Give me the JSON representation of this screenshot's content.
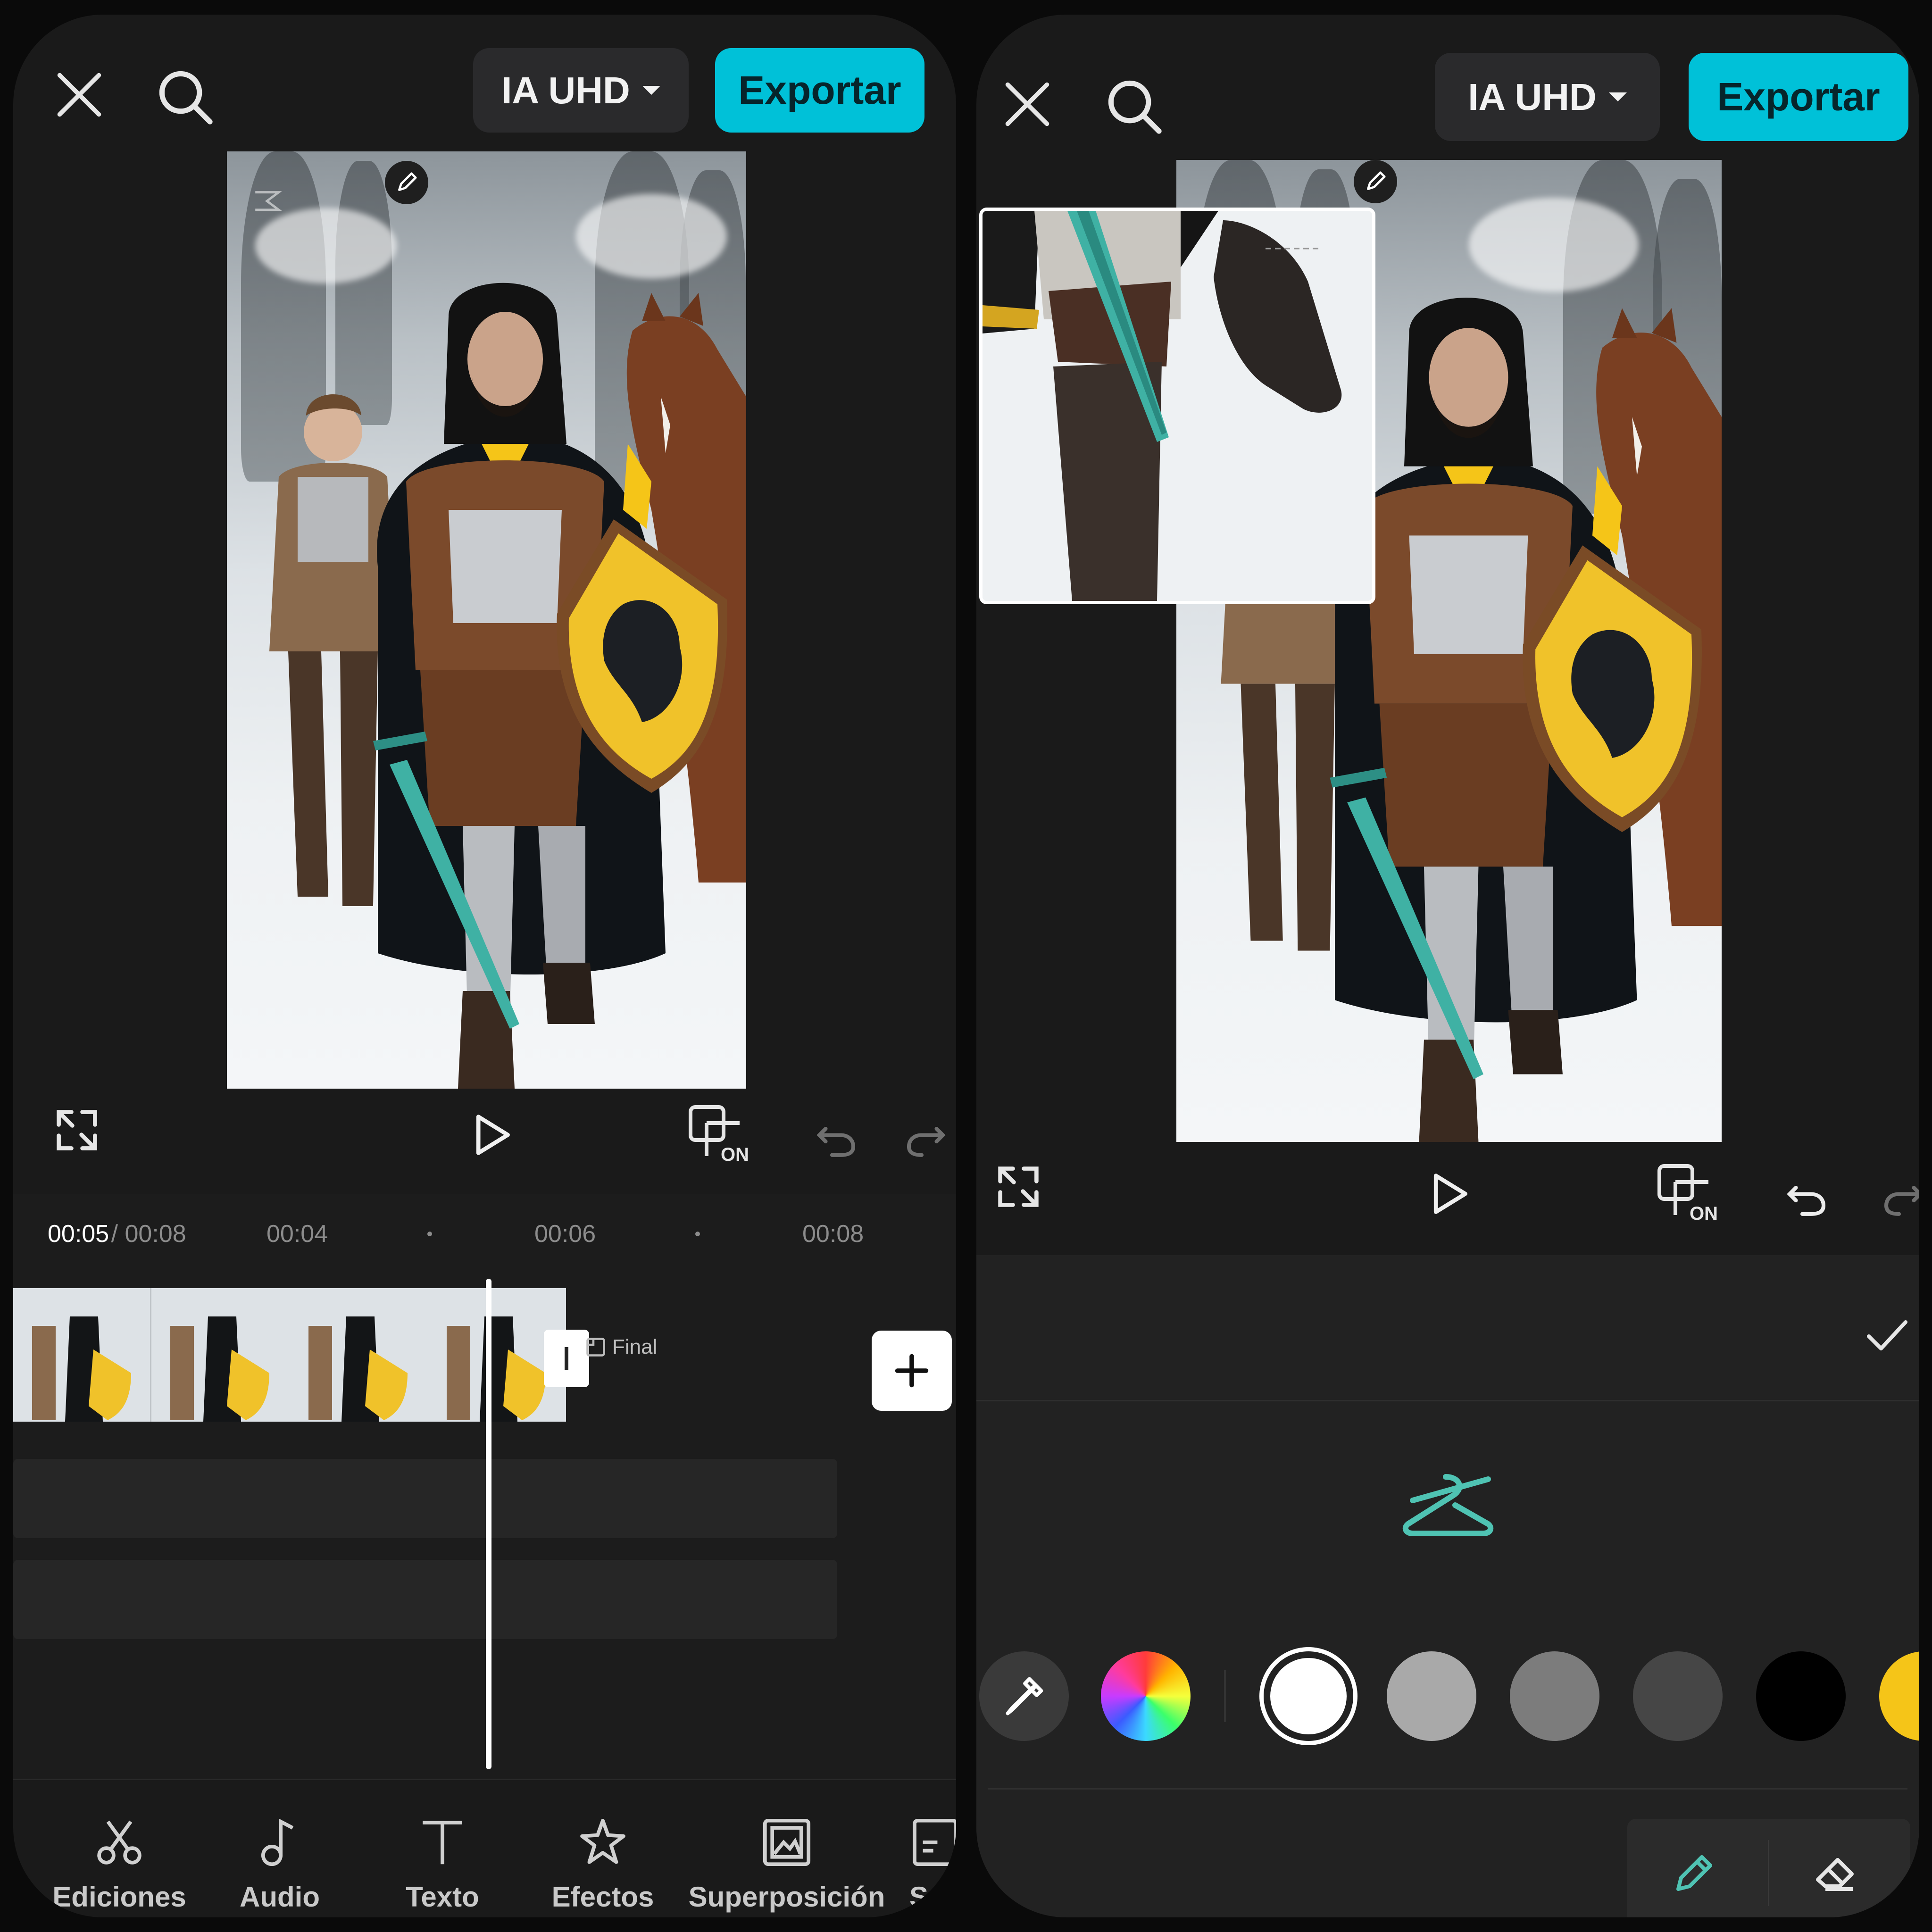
{
  "left": {
    "header": {
      "quality_label": "IA UHD",
      "export_label": "Exportar"
    },
    "timeline": {
      "current_time": "00:05",
      "total_time": "/ 00:08",
      "ticks": [
        "00:04",
        "00:06",
        "00:08"
      ],
      "end_label": "Final"
    },
    "toolbar": [
      {
        "label": "Ediciones",
        "icon": "scissors-icon"
      },
      {
        "label": "Audio",
        "icon": "music-note-icon"
      },
      {
        "label": "Texto",
        "icon": "text-icon"
      },
      {
        "label": "Efectos",
        "icon": "effects-star-icon"
      },
      {
        "label": "Superposición",
        "icon": "overlay-icon"
      },
      {
        "label": "Su",
        "icon": "subtitles-icon"
      }
    ]
  },
  "right": {
    "header": {
      "quality_label": "IA UHD",
      "export_label": "Exportar"
    },
    "palette": {
      "colors": [
        "#ffffff",
        "#a9a9a9",
        "#7c7c7c",
        "#464646",
        "#000000",
        "#f5c518"
      ],
      "selected": "#ffffff"
    }
  },
  "colors": {
    "accent": "#00c1d8",
    "background": "#1a1a1a",
    "teal_icon": "#4fc3b3"
  }
}
